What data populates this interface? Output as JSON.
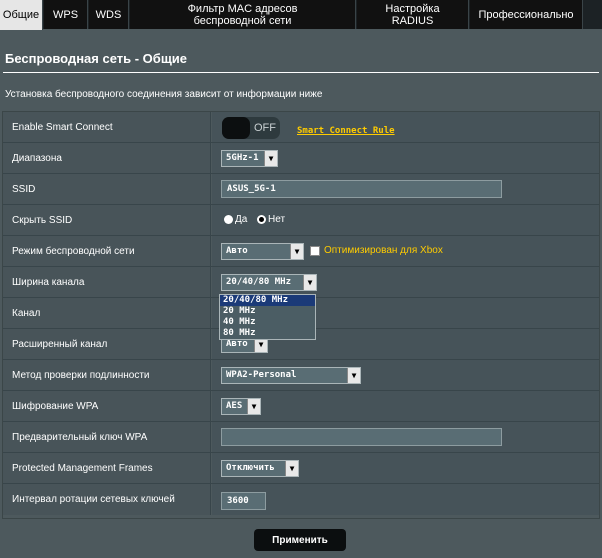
{
  "tabs": [
    {
      "label": "Общие"
    },
    {
      "label": "WPS"
    },
    {
      "label": "WDS"
    },
    {
      "label": "Фильтр MAC адресов беспроводной сети"
    },
    {
      "label": "Настройка RADIUS"
    },
    {
      "label": "Профессионально"
    }
  ],
  "page": {
    "title": "Беспроводная сеть - Общие",
    "description": "Установка беспроводного соединения зависит от информации ниже"
  },
  "form": {
    "smart_connect": {
      "label": "Enable Smart Connect",
      "toggle_text": "OFF",
      "rule_link": "Smart Connect Rule"
    },
    "band": {
      "label": "Диапазона",
      "value": "5GHz-1"
    },
    "ssid": {
      "label": "SSID",
      "value": "ASUS_5G-1"
    },
    "hide_ssid": {
      "label": "Скрыть SSID",
      "opt_yes": "Да",
      "opt_no": "Нет",
      "selected": "Нет"
    },
    "wireless_mode": {
      "label": "Режим беспроводной сети",
      "value": "Авто",
      "xbox_label": "Оптимизирован для Xbox"
    },
    "channel_width": {
      "label": "Ширина канала",
      "value": "20/40/80 MHz",
      "options": [
        "20/40/80 MHz",
        "20 MHz",
        "40 MHz",
        "80 MHz"
      ]
    },
    "channel": {
      "label": "Канал"
    },
    "ext_channel": {
      "label": "Расширенный канал",
      "value": "Авто"
    },
    "auth_method": {
      "label": "Метод проверки подлинности",
      "value": "WPA2-Personal"
    },
    "wpa_encryption": {
      "label": "Шифрование WPA",
      "value": "AES"
    },
    "wpa_key": {
      "label": "Предварительный ключ WPA",
      "value": ""
    },
    "pmf": {
      "label": "Protected Management Frames",
      "value": "Отключить"
    },
    "key_rotation": {
      "label": "Интервал ротации сетевых ключей",
      "value": "3600"
    }
  },
  "apply_label": "Применить",
  "colors": {
    "background": "#4d595d",
    "accent_link": "#ffcc00",
    "tab_active": "#e6e6e6",
    "selected_option": "#1b3a78"
  }
}
